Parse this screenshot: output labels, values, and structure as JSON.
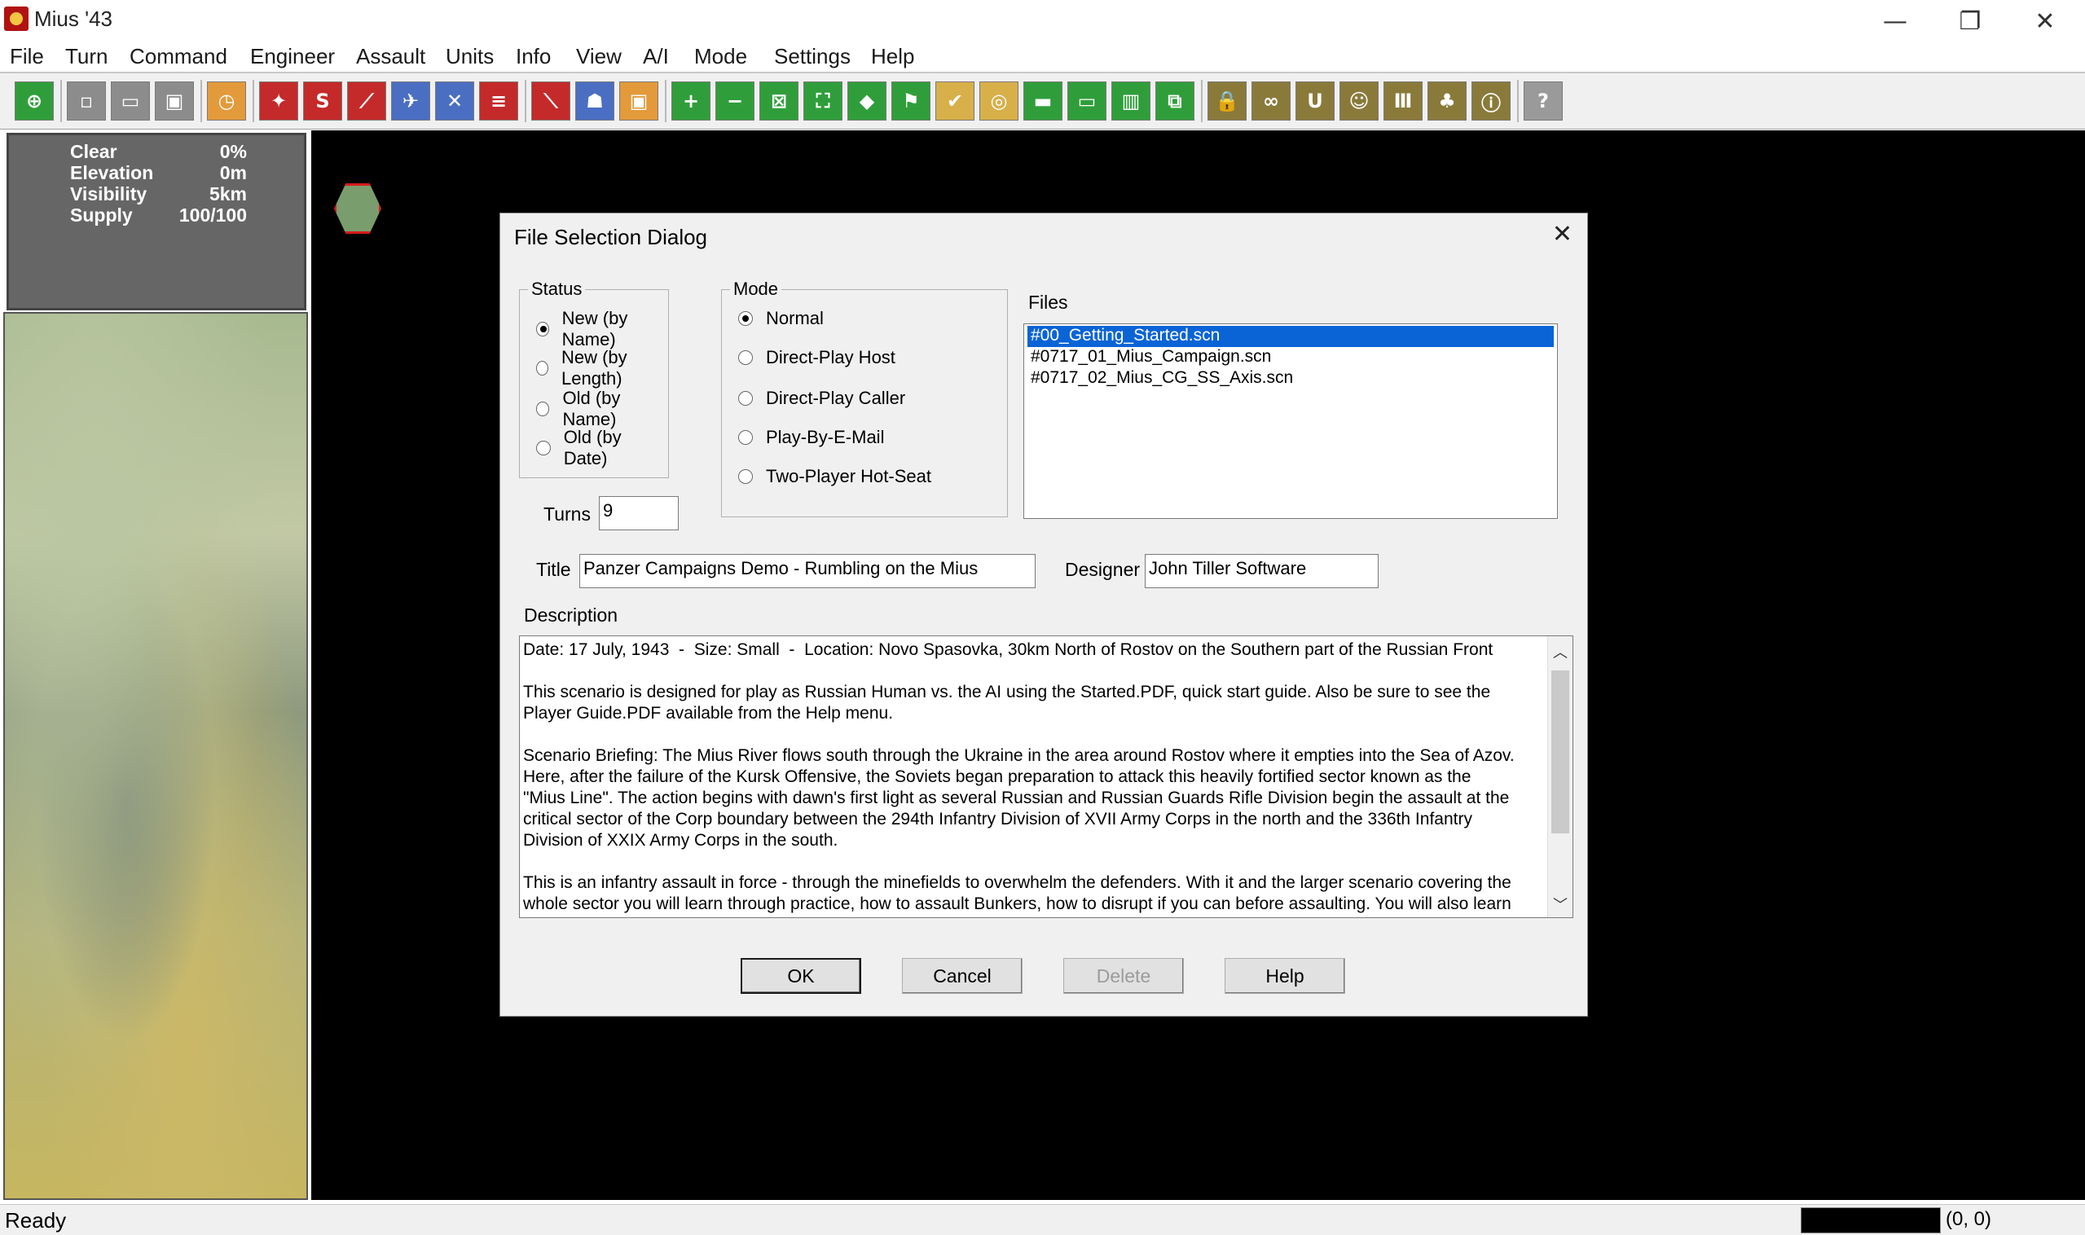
{
  "window": {
    "title": "Mius '43",
    "controls": {
      "minimize": "—",
      "restore": "❐",
      "close": "✕"
    }
  },
  "menu": [
    "File",
    "Turn",
    "Command",
    "Engineer",
    "Assault",
    "Units",
    "Info",
    "View",
    "A/I",
    "Mode",
    "Settings",
    "Help"
  ],
  "toolbar": {
    "buttons": [
      {
        "icon": "target-icon",
        "glyph": "⊕",
        "color": "#2f9e3a"
      },
      {
        "icon": "new-file-icon",
        "glyph": "▫",
        "color": "#8c8c8c"
      },
      {
        "icon": "open-folder-icon",
        "glyph": "▭",
        "color": "#8c8c8c"
      },
      {
        "icon": "save-icon",
        "glyph": "▣",
        "color": "#8c8c8c"
      },
      {
        "icon": "clock-icon",
        "glyph": "◷",
        "color": "#e39a3a"
      },
      {
        "icon": "unit-up-icon",
        "glyph": "✦",
        "color": "#c42a2a"
      },
      {
        "icon": "s-icon",
        "glyph": "S",
        "color": "#c42a2a"
      },
      {
        "icon": "artillery-icon",
        "glyph": "⟋",
        "color": "#c42a2a"
      },
      {
        "icon": "aircraft-icon",
        "glyph": "✈",
        "color": "#4a6ec2"
      },
      {
        "icon": "fighter-icon",
        "glyph": "✕",
        "color": "#4a6ec2"
      },
      {
        "icon": "list-icon",
        "glyph": "≡",
        "color": "#c42a2a"
      },
      {
        "icon": "line-icon",
        "glyph": "⟍",
        "color": "#c42a2a"
      },
      {
        "icon": "soldier-icon",
        "glyph": "☗",
        "color": "#4a6ec2"
      },
      {
        "icon": "portrait-icon",
        "glyph": "▣",
        "color": "#e39a3a"
      },
      {
        "icon": "zoom-in-icon",
        "glyph": "+",
        "color": "#2f9e3a"
      },
      {
        "icon": "zoom-out-icon",
        "glyph": "−",
        "color": "#2f9e3a"
      },
      {
        "icon": "grid-icon",
        "glyph": "⊠",
        "color": "#2f9e3a"
      },
      {
        "icon": "frame-icon",
        "glyph": "⛶",
        "color": "#2f9e3a"
      },
      {
        "icon": "diamond-icon",
        "glyph": "◆",
        "color": "#2f9e3a"
      },
      {
        "icon": "flag-icon",
        "glyph": "⚑",
        "color": "#2f9e3a"
      },
      {
        "icon": "check-icon",
        "glyph": "✔",
        "color": "#d7b04a"
      },
      {
        "icon": "coin-icon",
        "glyph": "◎",
        "color": "#d7b04a"
      },
      {
        "icon": "terrain-icon",
        "glyph": "▬",
        "color": "#2f9e3a"
      },
      {
        "icon": "monitor-icon",
        "glyph": "▭",
        "color": "#2f9e3a"
      },
      {
        "icon": "map-icon",
        "glyph": "▥",
        "color": "#2f9e3a"
      },
      {
        "icon": "windows-icon",
        "glyph": "⧉",
        "color": "#2f9e3a"
      },
      {
        "icon": "lock-icon",
        "glyph": "🔒",
        "color": "#8a7a3a"
      },
      {
        "icon": "binoculars-icon",
        "glyph": "∞",
        "color": "#8a7a3a"
      },
      {
        "icon": "u-icon",
        "glyph": "U",
        "color": "#8a7a3a"
      },
      {
        "icon": "face-icon",
        "glyph": "☺",
        "color": "#8a7a3a"
      },
      {
        "icon": "bars-icon",
        "glyph": "Ⅲ",
        "color": "#8a7a3a"
      },
      {
        "icon": "hierarchy-icon",
        "glyph": "♣",
        "color": "#8a7a3a"
      },
      {
        "icon": "info-icon",
        "glyph": "ⓘ",
        "color": "#8a7a3a"
      },
      {
        "icon": "help-icon",
        "glyph": "?",
        "color": "#9a9a9a"
      }
    ]
  },
  "info_panel": {
    "rows": [
      {
        "label": "Clear",
        "value": "0%"
      },
      {
        "label": "Elevation",
        "value": "0m"
      },
      {
        "label": "Visibility",
        "value": "5km"
      },
      {
        "label": "Supply",
        "value": "100/100"
      }
    ]
  },
  "dialog": {
    "title": "File Selection Dialog",
    "status": {
      "legend": "Status",
      "options": [
        "New (by Name)",
        "New (by Length)",
        "Old (by Name)",
        "Old (by Date)"
      ],
      "selected": 0
    },
    "mode": {
      "legend": "Mode",
      "options": [
        "Normal",
        "Direct-Play Host",
        "Direct-Play Caller",
        "Play-By-E-Mail",
        "Two-Player Hot-Seat"
      ],
      "selected": 0
    },
    "files": {
      "label": "Files",
      "items": [
        "#00_Getting_Started.scn",
        "#0717_01_Mius_Campaign.scn",
        "#0717_02_Mius_CG_SS_Axis.scn"
      ],
      "selected": 0
    },
    "turns_label": "Turns",
    "turns_value": "9",
    "title_label": "Title",
    "title_value": "Panzer Campaigns Demo - Rumbling on the Mius",
    "designer_label": "Designer",
    "designer_value": "John Tiller Software",
    "description_label": "Description",
    "description": "Date: 17 July, 1943  -  Size: Small  -  Location: Novo Spasovka, 30km North of Rostov on the Southern part of the Russian Front\n\nThis scenario is designed for play as Russian Human vs. the AI using the Started.PDF, quick start guide. Also be sure to see the\nPlayer Guide.PDF available from the Help menu.\n\nScenario Briefing: The Mius River flows south through the Ukraine in the area around Rostov where it empties into the Sea of Azov.\nHere, after the failure of the Kursk Offensive, the Soviets began preparation to attack this heavily fortified sector known as the\n\"Mius Line\". The action begins with dawn's first light as several Russian and Russian Guards Rifle Division begin the assault at the\ncritical sector of the Corp boundary between the 294th Infantry Division of XVII Army Corps in the north and the 336th Infantry\nDivision of XXIX Army Corps in the south.\n\nThis is an infantry assault in force - through the minefields to overwhelm the defenders. With it and the larger scenario covering the\nwhole sector you will learn through practice, how to assault Bunkers, how to disrupt if you can before assaulting. You will also learn",
    "buttons": {
      "ok": "OK",
      "cancel": "Cancel",
      "delete": "Delete",
      "help": "Help"
    },
    "close_glyph": "✕",
    "scroll_up": "︿",
    "scroll_down": "﹀"
  },
  "statusbar": {
    "text": "Ready",
    "coords": "(0, 0)"
  }
}
